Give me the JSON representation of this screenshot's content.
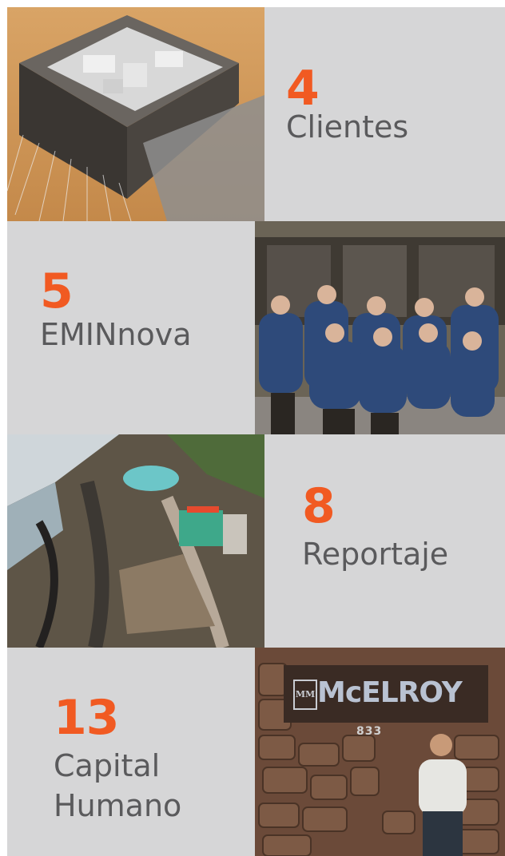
{
  "sections": [
    {
      "number": "4",
      "label": "Clientes"
    },
    {
      "number": "5",
      "label": "EMINnova"
    },
    {
      "number": "8",
      "label": "Reportaje"
    },
    {
      "number": "13",
      "label_line1": "Capital",
      "label_line2": "Humano"
    }
  ],
  "photo_sign": {
    "logo_mark": "MM",
    "brand": "McELROY",
    "street_number": "833"
  },
  "colors": {
    "accent": "#f15a22",
    "panel": "#d6d6d7",
    "label_text": "#5a5a5c"
  }
}
